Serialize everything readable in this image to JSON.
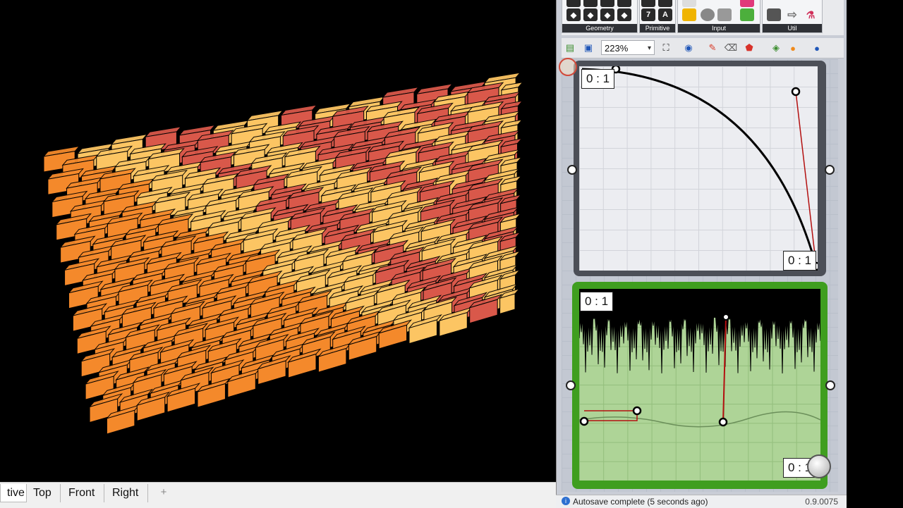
{
  "viewport": {
    "tabs": [
      {
        "label": "tive",
        "active": true
      },
      {
        "label": "Top",
        "active": false
      },
      {
        "label": "Front",
        "active": false
      },
      {
        "label": "Right",
        "active": false
      }
    ],
    "add_tab_symbol": "+"
  },
  "ribbon": {
    "groups": [
      {
        "label": "Geometry"
      },
      {
        "label": "Primitive"
      },
      {
        "label": "Input"
      },
      {
        "label": "Util"
      }
    ],
    "primitive_icons": [
      "7",
      "A"
    ]
  },
  "canvas_toolbar": {
    "zoom": "223%"
  },
  "graph_mapper_1": {
    "top_left_range": "0 : 1",
    "bottom_right_range": "0 : 1"
  },
  "graph_mapper_2": {
    "top_left_range": "0 : 1",
    "bottom_right_range": "0 : 1"
  },
  "status": {
    "message": "Autosave complete (5 seconds ago)",
    "version": "0.9.0075"
  },
  "colors": {
    "brick_orange": "#f4892b",
    "brick_yellow": "#fcc563",
    "brick_red": "#d9584a",
    "graph_green": "#3f9e1f"
  }
}
